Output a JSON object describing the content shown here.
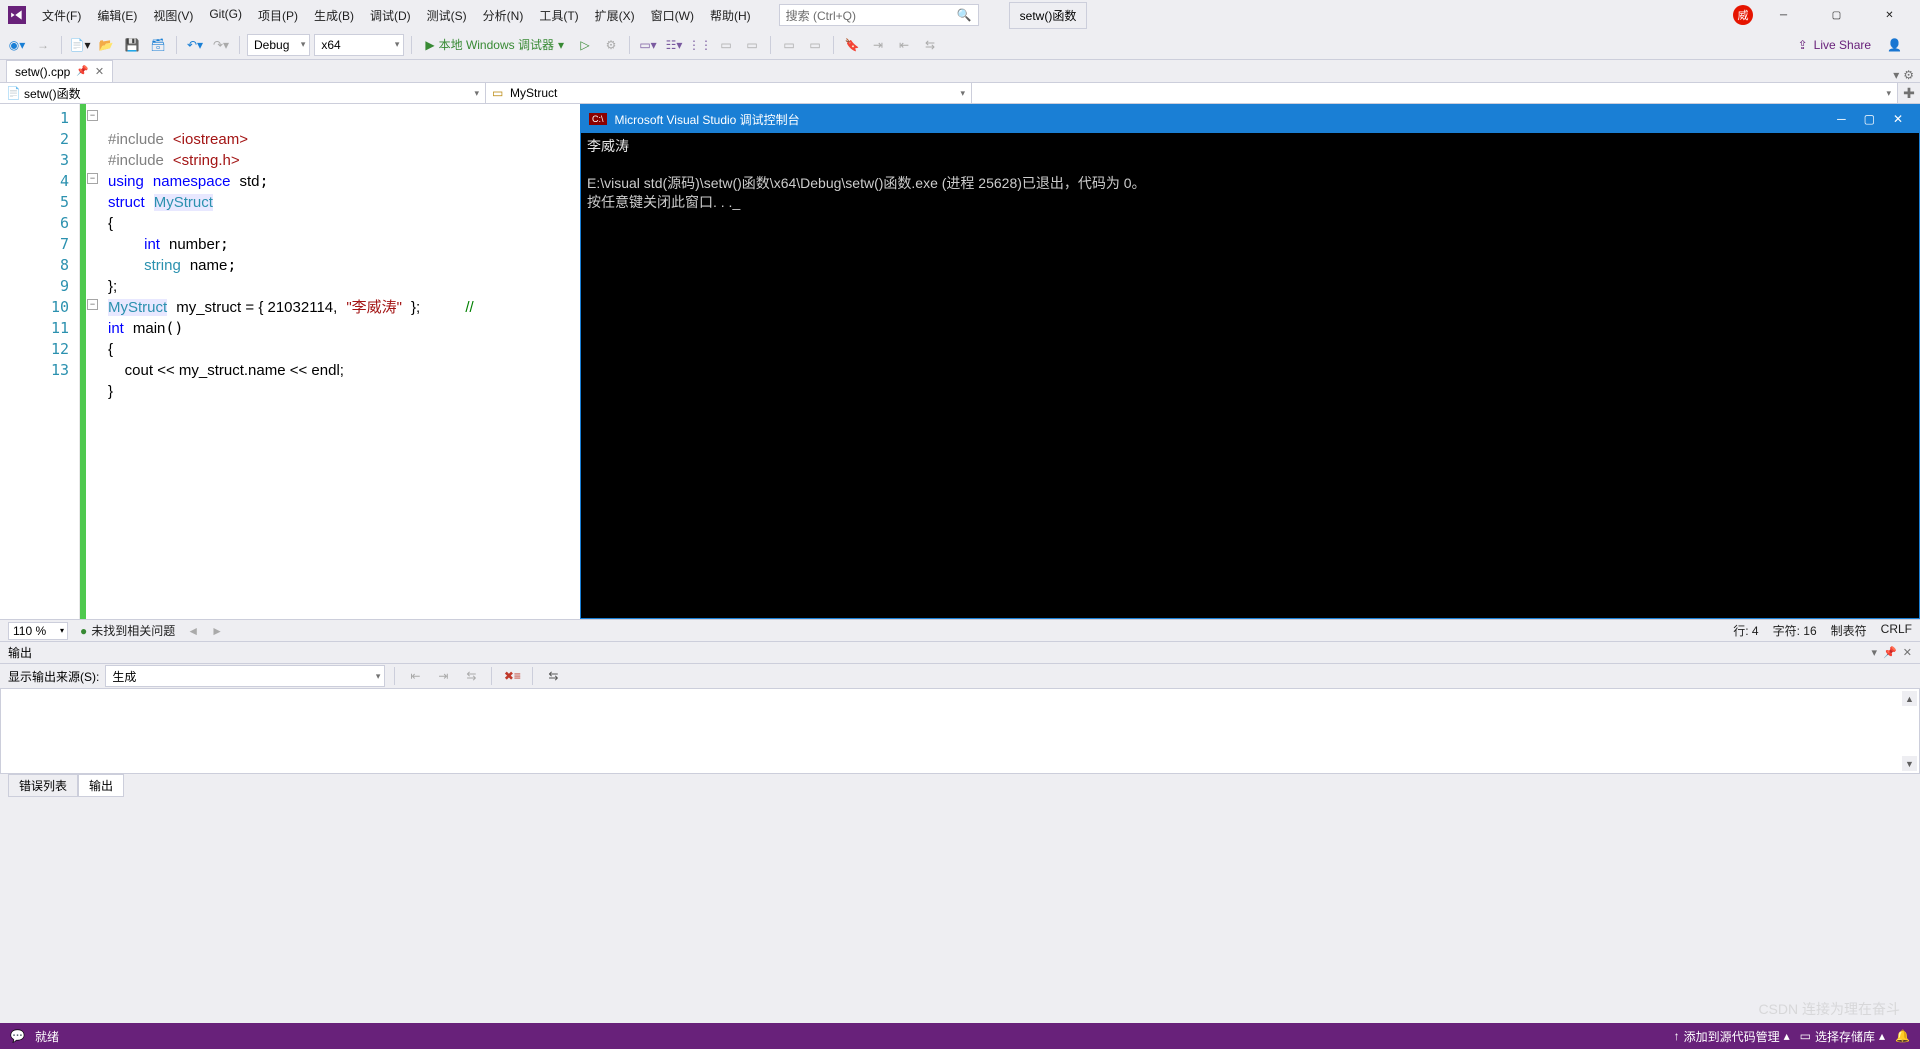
{
  "menu": [
    "文件(F)",
    "编辑(E)",
    "视图(V)",
    "Git(G)",
    "项目(P)",
    "生成(B)",
    "调试(D)",
    "测试(S)",
    "分析(N)",
    "工具(T)",
    "扩展(X)",
    "窗口(W)",
    "帮助(H)"
  ],
  "search": {
    "placeholder": "搜索 (Ctrl+Q)"
  },
  "project_name": "setw()函数",
  "avatar_letter": "威",
  "toolbar": {
    "config": "Debug",
    "platform": "x64",
    "debug_label": "本地 Windows 调试器"
  },
  "liveshare": "Live Share",
  "tab": {
    "name": "setw().cpp"
  },
  "nav": {
    "left": "setw()函数",
    "middle": "MyStruct",
    "right": ""
  },
  "code_lines": [
    1,
    2,
    3,
    4,
    5,
    6,
    7,
    8,
    9,
    10,
    11,
    12,
    13
  ],
  "code": {
    "l1": "#include <iostream>",
    "l2": "#include <string.h>",
    "l3_a": "using",
    "l3_b": "namespace",
    "l3_c": "std",
    "l4_a": "struct",
    "l4_b": "MyStruct",
    "l5": "{",
    "l6_a": "int",
    "l6_b": "number",
    "l7_a": "string",
    "l7_b": "name",
    "l8": "};",
    "l9_a": "MyStruct",
    "l9_b": "my_struct = { 21032114,",
    "l9_c": "\"李威涛\"",
    "l9_d": "};",
    "l9_e": "//",
    "l10_a": "int",
    "l10_b": "main",
    "l11": "{",
    "l12": "    cout << my_struct.name << endl;",
    "l13": "}"
  },
  "console": {
    "title": "Microsoft Visual Studio 调试控制台",
    "line1": "李威涛",
    "line2": "E:\\visual std(源码)\\setw()函数\\x64\\Debug\\setw()函数.exe (进程 25628)已退出，代码为 0。",
    "line3": "按任意键关闭此窗口. . ._"
  },
  "editor_status": {
    "zoom": "110 %",
    "issues": "未找到相关问题",
    "row": "行: 4",
    "col": "字符: 16",
    "tabs": "制表符",
    "eol": "CRLF"
  },
  "output": {
    "title": "输出",
    "source_label": "显示输出来源(S):",
    "source_value": "生成"
  },
  "bottom_tabs": {
    "errors": "错误列表",
    "output": "输出"
  },
  "statusbar": {
    "ready": "就绪",
    "scm": "添加到源代码管理",
    "repo": "选择存储库"
  },
  "watermark": "CSDN 连接为理在奋斗"
}
